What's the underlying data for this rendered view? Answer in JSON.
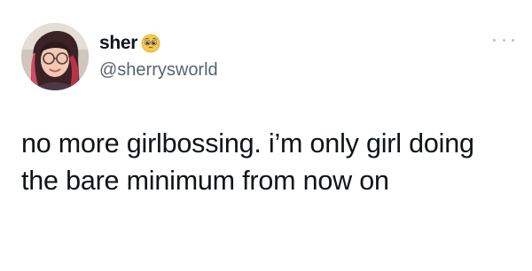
{
  "tweet": {
    "author": {
      "display_name": "sher",
      "handle": "@sherrysworld",
      "name_emoji": "pleading-face-emoji"
    },
    "more_icon": "more-dots-icon",
    "text_line1": "no more girlbossing. i’m only girl doing",
    "text_line2": "the bare minimum from now on"
  }
}
